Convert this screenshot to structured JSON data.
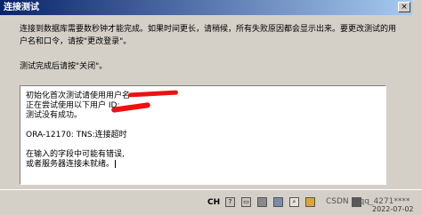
{
  "dialog": {
    "title": "连接测试",
    "close_label": "×",
    "intro": "连接到数据库需要数秒钟才能完成。如果时间更长，请稍候，所有失败原因都会显示出来。要更改测试的用户名和口令，请按\"更改登录\"。",
    "hint": "测试完成后请按\"关闭\"。",
    "output": {
      "line1": "初始化首次测试请使用用户名",
      "line2": "正在尝试使用以下用户 ID:",
      "line3": "测试没有成功。",
      "line4": "ORA-12170: TNS:连接超时",
      "line5": "在输入的字段中可能有错误,",
      "line6": "或者服务器连接未就绪。"
    }
  },
  "taskbar": {
    "ime": "CH",
    "tray_icons": [
      "help-icon",
      "keyboard-icon",
      "app-icon",
      "app-icon",
      "search-icon",
      "app-icon",
      "app-icon"
    ],
    "watermark": "CSDN @qq_4271****",
    "clock": "2022-07-02"
  },
  "colors": {
    "title_start": "#0a246a",
    "title_end": "#a6caf0",
    "redaction": "#ee1111"
  }
}
